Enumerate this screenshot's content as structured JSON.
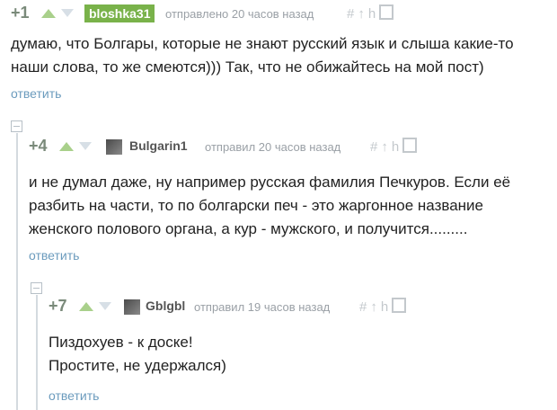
{
  "comments": [
    {
      "rating": "+1",
      "author": "bloshka31",
      "meta": "отправлено 20 часов назад",
      "text": "думаю, что Болгары, которые не знают русский язык и слыша какие-то наши слова, то же смеются))) Так, что не обижайтесь на мой пост)",
      "reply_label": "ответить"
    },
    {
      "rating": "+4",
      "author": "Bulgarin1",
      "meta": "отправил 20 часов назад",
      "text": "и не думал даже, ну например русская фамилия Печкуров. Если её разбить на части, то по болгарски печ - это жаргонное название женского полового органа, а кур - мужского, и получится.........",
      "reply_label": "ответить"
    },
    {
      "rating": "+7",
      "author": "Gblgbl",
      "meta": "отправил 19 часов назад",
      "text_line1": "Пиздохуев - к доске!",
      "text_line2": "Простите, не удержался)",
      "reply_label": "ответить"
    }
  ],
  "icons": [
    "arrow-up-icon",
    "arrow-down-icon",
    "hash-icon",
    "up-arrow-icon",
    "branch-icon",
    "save-icon",
    "collapse-icon"
  ],
  "colors": {
    "rating": "#7a8a7a",
    "author_tag": "#79b24a",
    "meta": "#9aa0a6",
    "reply": "#6b9bbd",
    "thread_line": "#d4dadf"
  }
}
